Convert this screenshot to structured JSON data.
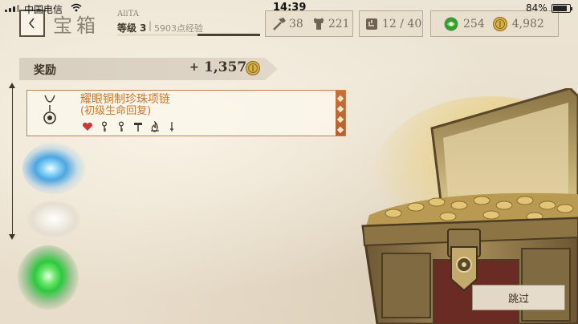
{
  "status_bar": {
    "carrier": "中国电信",
    "time": "14:39",
    "battery_percent": "84%",
    "battery_level": 0.84
  },
  "header": {
    "back_icon": "chevron-left-icon",
    "title": "宝箱",
    "player_name": "AliTA",
    "level": "等级 3",
    "separator": "|",
    "xp": "5903点经验",
    "xp_progress": 0.56
  },
  "resources": {
    "hammers": {
      "icon": "hammer-icon",
      "value": "38"
    },
    "armor": {
      "icon": "armor-icon",
      "value": "221"
    },
    "cards": {
      "icon": "card-deck-icon",
      "value": "12 / 40"
    },
    "gems": {
      "icon": "green-gem-icon",
      "value": "254"
    },
    "gold": {
      "icon": "gold-coin-icon",
      "value": "4,982"
    }
  },
  "reward": {
    "label": "奖励",
    "plus": "+",
    "amount": "1,357",
    "icon": "gold-coin-icon"
  },
  "item": {
    "icon": "necklace-icon",
    "name": "耀眼铜制珍珠项链",
    "subtitle": "(初级生命回复)",
    "traits": [
      "heart-icon",
      "key-icon",
      "key-icon",
      "hammer-icon",
      "flame-icon",
      "dagger-icon"
    ]
  },
  "colors": {
    "accent_orange": "#c8782f",
    "strip_orange": "#c06934",
    "text_dark": "#3e3428",
    "parchment": "#ece3d2",
    "gem_blue": "#4fa6e0",
    "gem_green": "#2ec83e"
  },
  "skip": {
    "label": "跳过"
  }
}
